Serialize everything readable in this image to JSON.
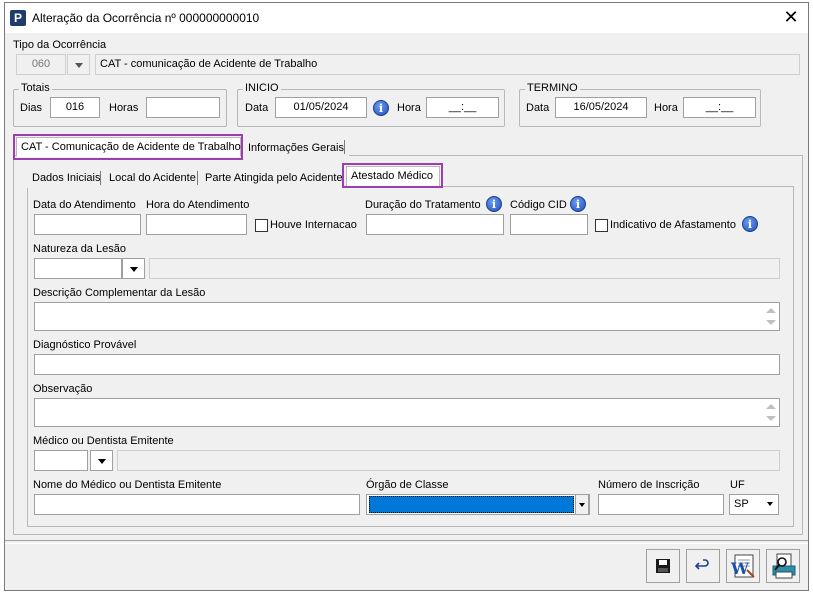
{
  "window": {
    "title": "Alteração da Ocorrência nº 000000000010",
    "app_icon": "P",
    "close_glyph": "✕"
  },
  "tipo": {
    "label": "Tipo da Ocorrência",
    "code": "060",
    "description": "CAT - comunicação de Acidente de Trabalho"
  },
  "totais": {
    "legend": "Totais",
    "dias_label": "Dias",
    "dias_value": "016",
    "horas_label": "Horas",
    "horas_value": ""
  },
  "inicio": {
    "legend": "INICIO",
    "data_label": "Data",
    "data_value": "01/05/2024",
    "hora_label": "Hora",
    "hora_value": "__:__"
  },
  "termino": {
    "legend": "TERMINO",
    "data_label": "Data",
    "data_value": "16/05/2024",
    "hora_label": "Hora",
    "hora_value": "__:__"
  },
  "main_tabs": [
    {
      "label": "CAT - Comunicação de Acidente de Trabalho",
      "active": true
    },
    {
      "label": "Informações Gerais",
      "active": false
    }
  ],
  "sub_tabs": [
    {
      "label": "Dados Iniciais",
      "active": false
    },
    {
      "label": "Local do Acidente",
      "active": false
    },
    {
      "label": "Parte Atingida pelo Acidente",
      "active": false
    },
    {
      "label": "Atestado Médico",
      "active": true
    }
  ],
  "form": {
    "data_atendimento_label": "Data do Atendimento",
    "hora_atendimento_label": "Hora do Atendimento",
    "houve_internacao_label": "Houve Internacao",
    "duracao_tratamento_label": "Duração do Tratamento",
    "codigo_cid_label": "Código CID",
    "indicativo_afastamento_label": "Indicativo de Afastamento",
    "natureza_lesao_label": "Natureza da Lesão",
    "descricao_complementar_label": "Descrição Complementar da Lesão",
    "diagnostico_label": "Diagnóstico Provável",
    "observacao_label": "Observação",
    "medico_emitente_label": "Médico ou Dentista Emitente",
    "nome_medico_label": "Nome do Médico ou Dentista Emitente",
    "orgao_classe_label": "Órgão de Classe",
    "numero_inscricao_label": "Número de Inscrição",
    "uf_label": "UF",
    "uf_value": "SP",
    "info_glyph": "i"
  },
  "toolbar": {
    "icons": [
      "save-icon",
      "undo-icon",
      "word-document-icon",
      "print-preview-icon"
    ]
  },
  "colors": {
    "tab_highlight": "#9b3fb0",
    "selection": "#0078d7"
  }
}
